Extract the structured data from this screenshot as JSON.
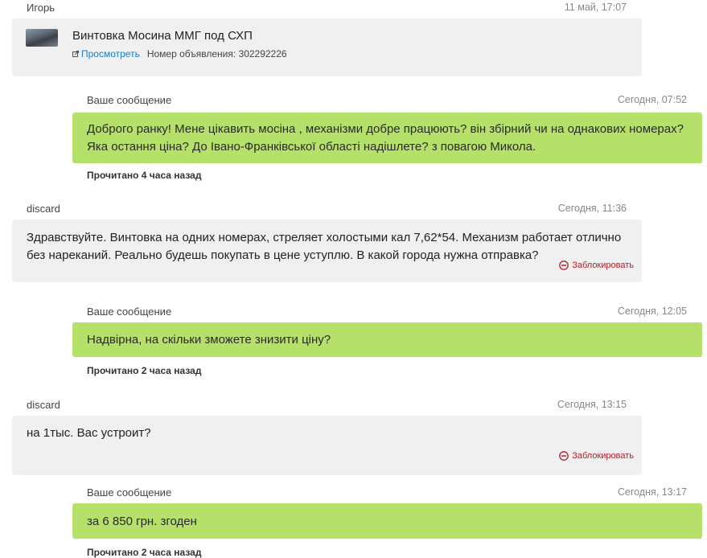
{
  "ad_message": {
    "author": "Игорь",
    "time": "11 май, 17:07",
    "title": "Винтовка Мосина ММГ под СХП",
    "view_link": "Просмотреть",
    "ad_number": "Номер объявления: 302292226"
  },
  "messages": [
    {
      "type": "outgoing",
      "author": "Ваше сообщение",
      "time": "Сегодня, 07:52",
      "text": "Доброго ранку! Мене цікавить мосіна , механізми добре працюють? він збірний чи на однакових номерах? Яка остання ціна? До Івано-Франківської області надішлете? з повагою Микола.",
      "read": "Прочитано 4 часа назад"
    },
    {
      "type": "incoming",
      "author": "discard",
      "time": "Сегодня, 11:36",
      "text": "Здравствуйте. Винтовка на одних номерах, стреляет холостыми кал 7,62*54. Механизм работает отлично без нареканий. Реально будешь покупать в цене уступлю. В какой города нужна отправка?",
      "block": "Заблокировать"
    },
    {
      "type": "outgoing",
      "author": "Ваше сообщение",
      "time": "Сегодня, 12:05",
      "text": "Надвірна, на скільки зможете знизити ціну?",
      "read": "Прочитано 2 часа назад"
    },
    {
      "type": "incoming",
      "author": "discard",
      "time": "Сегодня, 13:15",
      "text": "на 1тыс. Вас устроит?",
      "block": "Заблокировать"
    },
    {
      "type": "outgoing",
      "author": "Ваше сообщение",
      "time": "Сегодня, 13:17",
      "text": "за 6 850 грн. згоден",
      "read": "Прочитано 2 часа назад"
    }
  ],
  "colors": {
    "outgoing_bubble": "#b5e06a",
    "incoming_bubble": "#f0f0f0",
    "link": "#1a80c8",
    "block": "#b0202a"
  }
}
